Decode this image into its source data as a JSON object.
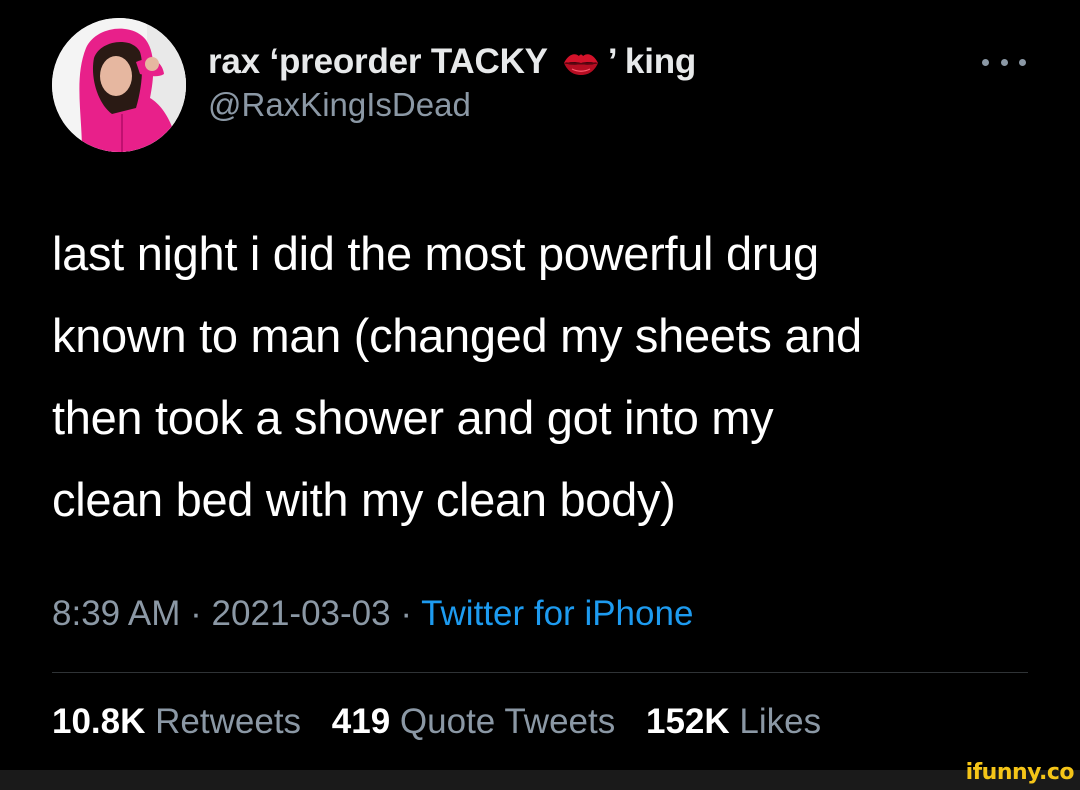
{
  "author": {
    "display_name_prefix": "rax ‘preorder TACKY",
    "display_name_emoji": "lips-kiss-icon",
    "display_name_suffix": "’ king",
    "handle": "@RaxKingIsDead"
  },
  "more_icon": "more-horizontal-icon",
  "tweet": {
    "lines": [
      "last night i did the most powerful drug",
      "known to man (changed my sheets and",
      "then took a shower and got into my",
      "clean bed with my clean body)"
    ]
  },
  "meta": {
    "time": "8:39 AM",
    "separator": "·",
    "date": "2021-03-03",
    "source": "Twitter for iPhone"
  },
  "stats": {
    "retweets_count": "10.8K",
    "retweets_label": "Retweets",
    "quotes_count": "419",
    "quotes_label": "Quote Tweets",
    "likes_count": "152K",
    "likes_label": "Likes"
  },
  "watermark": "ifunny.co",
  "colors": {
    "background": "#000000",
    "primary_text": "#ffffff",
    "secondary_text": "#8b98a5",
    "link": "#1d9bf0",
    "avatar_accent": "#e8208a",
    "watermark": "#f5c518"
  }
}
